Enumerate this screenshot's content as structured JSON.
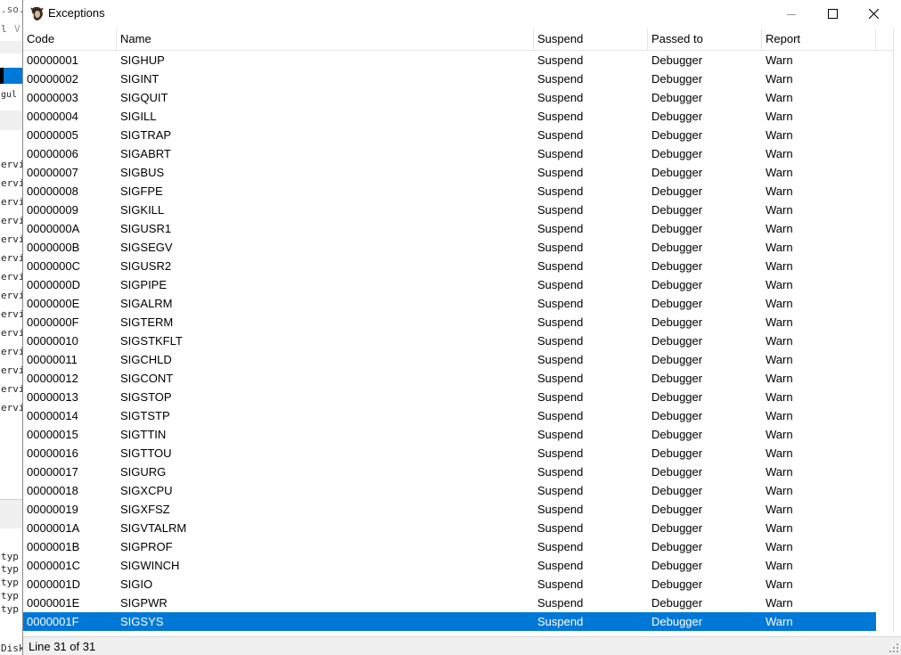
{
  "background_app": {
    "fragments": [
      ".so.i",
      "l",
      "V",
      "gul ar",
      "ervi",
      "ervi",
      "ervi",
      "ervi",
      "ervi",
      "ervi",
      "ervi",
      "ervi",
      "ervi",
      "ervi",
      "ervi",
      "ervi",
      "ervi",
      "ervi",
      "typ",
      "typ",
      "typ",
      "typ",
      "typ",
      "Disk"
    ]
  },
  "window": {
    "title": "Exceptions",
    "icon": "gnu-head-icon",
    "controls": [
      "minimize-icon",
      "maximize-icon",
      "close-icon"
    ]
  },
  "table": {
    "columns": [
      "Code",
      "Name",
      "Suspend",
      "Passed to",
      "Report"
    ],
    "rows": [
      [
        "00000001",
        "SIGHUP",
        "Suspend",
        "Debugger",
        "Warn"
      ],
      [
        "00000002",
        "SIGINT",
        "Suspend",
        "Debugger",
        "Warn"
      ],
      [
        "00000003",
        "SIGQUIT",
        "Suspend",
        "Debugger",
        "Warn"
      ],
      [
        "00000004",
        "SIGILL",
        "Suspend",
        "Debugger",
        "Warn"
      ],
      [
        "00000005",
        "SIGTRAP",
        "Suspend",
        "Debugger",
        "Warn"
      ],
      [
        "00000006",
        "SIGABRT",
        "Suspend",
        "Debugger",
        "Warn"
      ],
      [
        "00000007",
        "SIGBUS",
        "Suspend",
        "Debugger",
        "Warn"
      ],
      [
        "00000008",
        "SIGFPE",
        "Suspend",
        "Debugger",
        "Warn"
      ],
      [
        "00000009",
        "SIGKILL",
        "Suspend",
        "Debugger",
        "Warn"
      ],
      [
        "0000000A",
        "SIGUSR1",
        "Suspend",
        "Debugger",
        "Warn"
      ],
      [
        "0000000B",
        "SIGSEGV",
        "Suspend",
        "Debugger",
        "Warn"
      ],
      [
        "0000000C",
        "SIGUSR2",
        "Suspend",
        "Debugger",
        "Warn"
      ],
      [
        "0000000D",
        "SIGPIPE",
        "Suspend",
        "Debugger",
        "Warn"
      ],
      [
        "0000000E",
        "SIGALRM",
        "Suspend",
        "Debugger",
        "Warn"
      ],
      [
        "0000000F",
        "SIGTERM",
        "Suspend",
        "Debugger",
        "Warn"
      ],
      [
        "00000010",
        "SIGSTKFLT",
        "Suspend",
        "Debugger",
        "Warn"
      ],
      [
        "00000011",
        "SIGCHLD",
        "Suspend",
        "Debugger",
        "Warn"
      ],
      [
        "00000012",
        "SIGCONT",
        "Suspend",
        "Debugger",
        "Warn"
      ],
      [
        "00000013",
        "SIGSTOP",
        "Suspend",
        "Debugger",
        "Warn"
      ],
      [
        "00000014",
        "SIGTSTP",
        "Suspend",
        "Debugger",
        "Warn"
      ],
      [
        "00000015",
        "SIGTTIN",
        "Suspend",
        "Debugger",
        "Warn"
      ],
      [
        "00000016",
        "SIGTTOU",
        "Suspend",
        "Debugger",
        "Warn"
      ],
      [
        "00000017",
        "SIGURG",
        "Suspend",
        "Debugger",
        "Warn"
      ],
      [
        "00000018",
        "SIGXCPU",
        "Suspend",
        "Debugger",
        "Warn"
      ],
      [
        "00000019",
        "SIGXFSZ",
        "Suspend",
        "Debugger",
        "Warn"
      ],
      [
        "0000001A",
        "SIGVTALRM",
        "Suspend",
        "Debugger",
        "Warn"
      ],
      [
        "0000001B",
        "SIGPROF",
        "Suspend",
        "Debugger",
        "Warn"
      ],
      [
        "0000001C",
        "SIGWINCH",
        "Suspend",
        "Debugger",
        "Warn"
      ],
      [
        "0000001D",
        "SIGIO",
        "Suspend",
        "Debugger",
        "Warn"
      ],
      [
        "0000001E",
        "SIGPWR",
        "Suspend",
        "Debugger",
        "Warn"
      ],
      [
        "0000001F",
        "SIGSYS",
        "Suspend",
        "Debugger",
        "Warn"
      ]
    ],
    "selected_index": 30
  },
  "status": {
    "text": "Line 31 of 31"
  },
  "colors": {
    "selection": "#0078d7",
    "selection_text": "#ffffff",
    "background_accent": "#0078d7"
  }
}
